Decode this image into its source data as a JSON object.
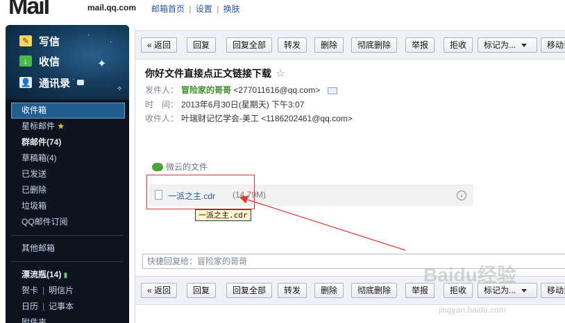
{
  "header": {
    "logo_text": "MaiI",
    "logo_sub": "mail.qq.com",
    "nav": [
      "邮箱首页",
      "设置",
      "换肤"
    ],
    "separator": "|"
  },
  "sidebar": {
    "actions": [
      {
        "label": "写信",
        "icon": "pencil-icon"
      },
      {
        "label": "收信",
        "icon": "download-icon"
      },
      {
        "label": "通讯录",
        "icon": "contacts-icon"
      }
    ],
    "folders": [
      {
        "label": "收件箱",
        "active": true
      },
      {
        "label": "星标邮件",
        "badge": "★"
      },
      {
        "label": "群邮件(74)",
        "bold": true
      },
      {
        "label": "草稿箱(4)"
      },
      {
        "label": "已发送"
      },
      {
        "label": "已删除"
      },
      {
        "label": "垃圾箱"
      },
      {
        "label": "QQ邮件订阅"
      }
    ],
    "other_mailboxes": "其他邮箱",
    "drift_bottle": "漂流瓶(14)",
    "misc_row1": [
      "贺卡",
      "明信片"
    ],
    "misc_row2": [
      "日历",
      "记事本"
    ],
    "attachments": "附件夹"
  },
  "toolbar": {
    "back": "« 返回",
    "reply": "回复",
    "reply_all": "回复全部",
    "forward": "转发",
    "delete": "删除",
    "delete_perm": "彻底删除",
    "report": "举报",
    "reject": "拒收",
    "mark_as": "标记为...",
    "move_to": "移动到"
  },
  "email": {
    "subject": "你好文件直接点正文链接下载",
    "star": "☆",
    "from_label": "发件人：",
    "from_name": "冒险家的哥哥",
    "from_addr": "<277011616@qq.com>",
    "time_label": "时　间：",
    "time_value": "2013年6月30日(星期天) 下午3:07",
    "to_label": "收件人：",
    "to_name": "叶瑞财记忆学会-美工",
    "to_addr": "<1186202461@qq.com>"
  },
  "attachment": {
    "section_label": "微云的文件",
    "filename": "一派之主.cdr",
    "size": "(14.79M)",
    "tooltip": "一派之主.cdr"
  },
  "quick_reply": {
    "placeholder": "快捷回复给：冒险家的哥哥"
  },
  "watermark": {
    "text": "Baidu经验",
    "url": "jingyan.baidu.com"
  },
  "colors": {
    "sidebar_bg": "#0d1420",
    "active_folder": "#1f5e8f",
    "link_blue": "#2459a8",
    "sender_green": "#3f8f2a",
    "annotation_red": "#d33"
  }
}
